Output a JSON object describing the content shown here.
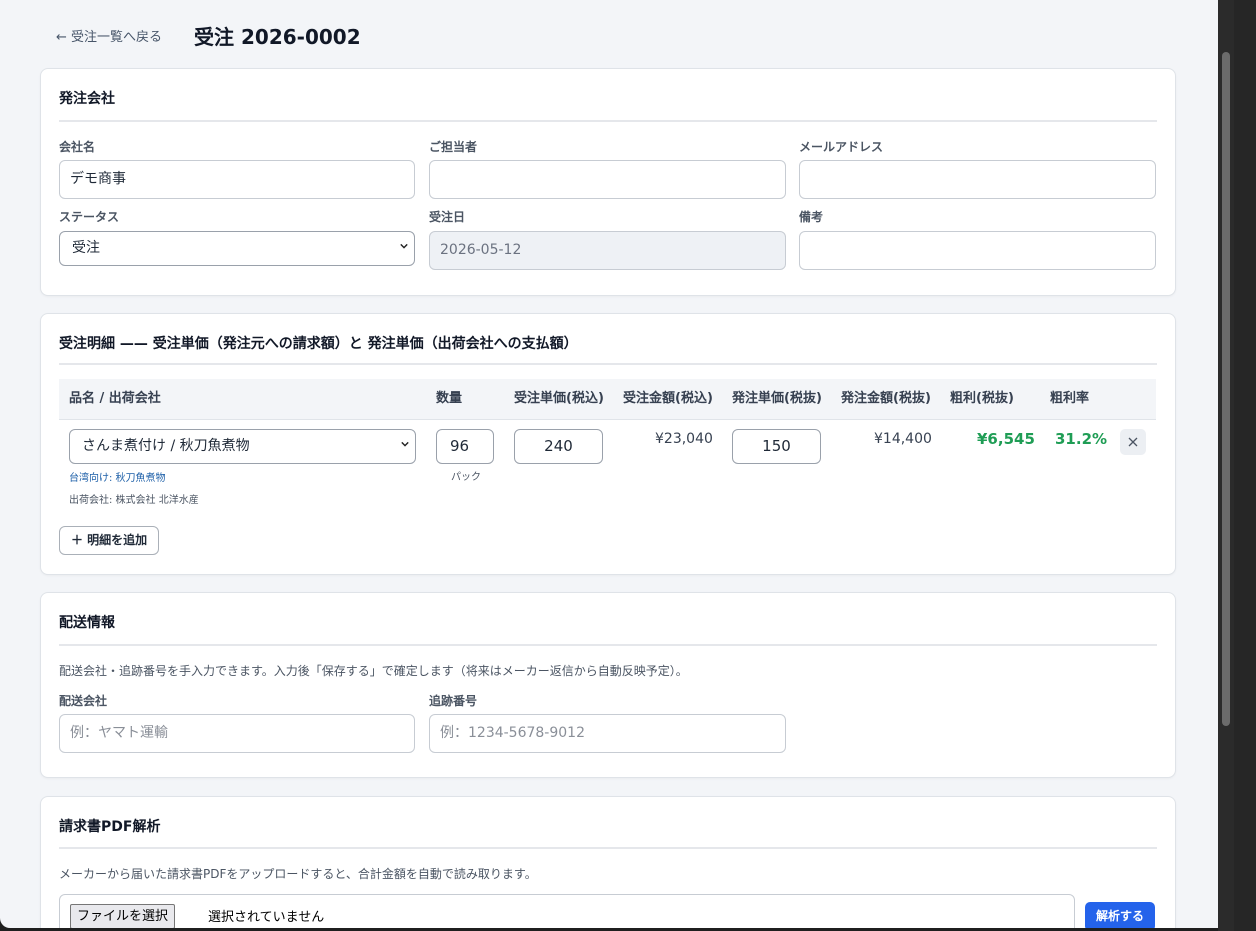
{
  "header": {
    "back_label": "← 受注一覧へ戻る",
    "page_title": "受注 2026-0002"
  },
  "orderer": {
    "section_title": "発注会社",
    "company_label": "会社名",
    "company_value": "デモ商事",
    "contact_label": "ご担当者",
    "contact_value": "",
    "email_label": "メールアドレス",
    "email_value": "",
    "status_label": "ステータス",
    "status_value": "受注",
    "order_date_label": "受注日",
    "order_date_value": "2026-05-12",
    "notes_label": "備考",
    "notes_value": ""
  },
  "items": {
    "section_title": "受注明細 —— 受注単価（発注元への請求額）と 発注単価（出荷会社への支払額）",
    "columns": [
      "品名 / 出荷会社",
      "数量",
      "受注単価(税込)",
      "受注金額(税込)",
      "発注単価(税抜)",
      "発注金額(税抜)",
      "粗利(税抜)",
      "粗利率"
    ],
    "rows": [
      {
        "product": "さんま煮付け / 秋刀魚煮物",
        "sub_taiwan": "台湾向け: 秋刀魚煮物",
        "shipper": "出荷会社: 株式会社 北洋水産",
        "qty": "96",
        "unit": "パック",
        "order_price": "240",
        "order_amount": "¥23,040",
        "purchase_price": "150",
        "purchase_amount": "¥14,400",
        "gross_profit": "¥6,545",
        "margin": "31.2%"
      }
    ],
    "add_label": "＋ 明細を追加"
  },
  "shipping": {
    "section_title": "配送情報",
    "description": "配送会社・追跡番号を手入力できます。入力後「保存する」で確定します（将来はメーカー返信から自動反映予定）。",
    "carrier_label": "配送会社",
    "carrier_placeholder": "例：ヤマト運輸",
    "tracking_label": "追跡番号",
    "tracking_placeholder": "例：1234-5678-9012"
  },
  "invoice": {
    "section_title": "請求書PDF解析",
    "description": "メーカーから届いた請求書PDFをアップロードすると、合計金額を自動で読み取ります。",
    "file_button": "ファイルを選択",
    "file_status": "選択されていません",
    "analyze_button": "解析する"
  },
  "colors": {
    "accent": "#2463eb",
    "profit": "#1f9d55",
    "link": "#1d5fa8"
  }
}
